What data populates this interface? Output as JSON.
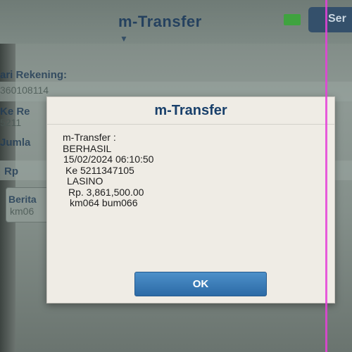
{
  "background": {
    "header_title": "m-Transfer",
    "send_button": "Ser",
    "from_account_label": "ari Rekening:",
    "from_account_value": "360108114",
    "to_label": "Ke Re",
    "to_value": "5211",
    "amount_label": "Jumla",
    "currency_label": "Rp",
    "message_label": "Berita",
    "message_value": "km06"
  },
  "dialog": {
    "title": "m-Transfer",
    "lines": [
      "m-Transfer :",
      "BERHASIL",
      "15/02/2024 06:10:50",
      "Ke 5211347105",
      "LASINO",
      "Rp. 3,861,500.00",
      "km064 bum066"
    ],
    "ok_label": "OK"
  },
  "colors": {
    "dialog_title": "#19406b",
    "ok_button": "#2c6aa6",
    "status_indicator": "#3fa33f",
    "glitch_line": "#e541d8"
  }
}
